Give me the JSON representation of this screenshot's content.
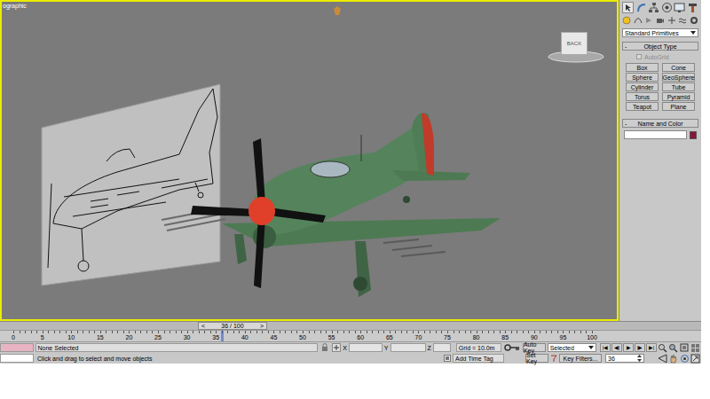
{
  "viewport": {
    "label": "ographic",
    "viewcube": "BACK"
  },
  "command_panel": {
    "category": "Standard Primitives",
    "object_type": {
      "sign": "-",
      "title": "Object Type",
      "autogrid": {
        "label": "AutoGrid",
        "checked": false,
        "disabled": true
      },
      "buttons": [
        "Box",
        "Cone",
        "Sphere",
        "GeoSphere",
        "Cylinder",
        "Tube",
        "Torus",
        "Pyramid",
        "Teapot",
        "Plane"
      ]
    },
    "name_and_color": {
      "sign": "-",
      "title": "Name and Color",
      "name": "",
      "color": "#8b1538"
    }
  },
  "time_slider": {
    "label": "36 / 100",
    "prev": "<",
    "next": ">",
    "level": 0.36
  },
  "track_bar": {
    "ticks": [
      "0",
      "5",
      "10",
      "15",
      "20",
      "25",
      "30",
      "35",
      "40",
      "45",
      "50",
      "55",
      "60",
      "65",
      "70",
      "75",
      "80",
      "85",
      "90",
      "95",
      "100"
    ]
  },
  "status_bar": {
    "selection": "None Selected",
    "prompt": "Click and drag to select and move objects",
    "coords": [
      {
        "axis": "X",
        "value": ""
      },
      {
        "axis": "Y",
        "value": ""
      },
      {
        "axis": "Z",
        "value": ""
      }
    ],
    "grid": "Grid = 10.0m",
    "add_time_tag": "Add Time Tag",
    "auto_key": "Auto Key",
    "key_mode": "Selected",
    "set_key": "Set Key",
    "key_filters": "Key Filters...",
    "frame": "36",
    "playback": [
      "|◀",
      "◀|",
      "▶",
      "|▶",
      "▶|"
    ]
  }
}
